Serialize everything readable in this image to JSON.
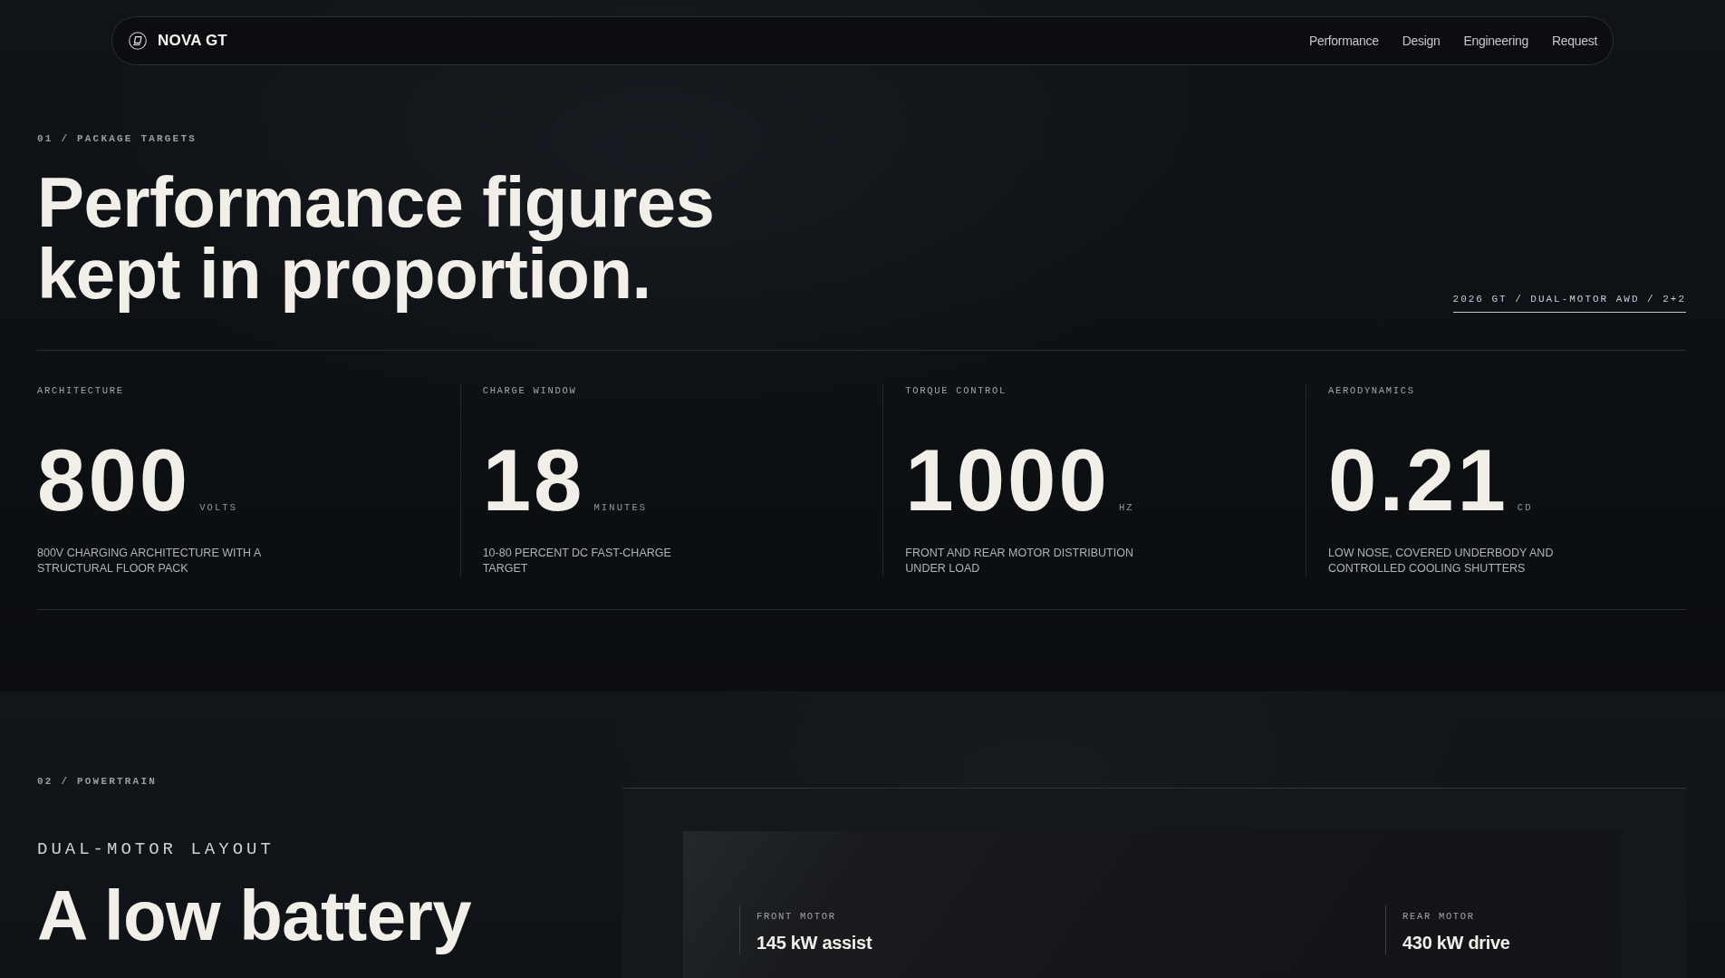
{
  "nav": {
    "brand": "NOVA GT",
    "links": [
      "Performance",
      "Design",
      "Engineering",
      "Request"
    ]
  },
  "package_targets": {
    "eyebrow": "01 / PACKAGE TARGETS",
    "heading": "Performance figures kept in proportion.",
    "spec_summary": "2026 GT / DUAL-MOTOR AWD / 2+2",
    "stats": [
      {
        "label": "ARCHITECTURE",
        "value": "800",
        "unit": "VOLTS",
        "description": "800V CHARGING ARCHITECTURE WITH A STRUCTURAL FLOOR PACK"
      },
      {
        "label": "CHARGE WINDOW",
        "value": "18",
        "unit": "MINUTES",
        "description": "10-80 PERCENT DC FAST-CHARGE TARGET"
      },
      {
        "label": "TORQUE CONTROL",
        "value": "1000",
        "unit": "HZ",
        "description": "FRONT AND REAR MOTOR DISTRIBUTION UNDER LOAD"
      },
      {
        "label": "AERODYNAMICS",
        "value": "0.21",
        "unit": "CD",
        "description": "LOW NOSE, COVERED UNDERBODY AND CONTROLLED COOLING SHUTTERS"
      }
    ]
  },
  "powertrain": {
    "eyebrow": "02 / POWERTRAIN",
    "subtitle": "DUAL-MOTOR LAYOUT",
    "heading": "A low battery",
    "motors": [
      {
        "label": "FRONT MOTOR",
        "value": "145 kW assist"
      },
      {
        "label": "REAR MOTOR",
        "value": "430 kW drive"
      }
    ]
  }
}
